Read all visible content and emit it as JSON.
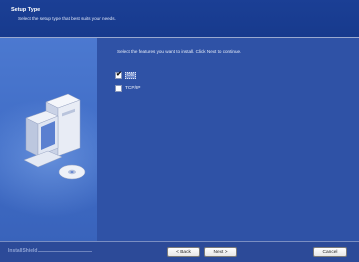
{
  "header": {
    "title": "Setup Type",
    "subtitle": "Select the setup type that best suits your needs."
  },
  "main": {
    "instruction": "Select the features you want to install. Click Next to continue.",
    "features": [
      {
        "label": "OS",
        "checked": true
      },
      {
        "label": "TCP/IP",
        "checked": false
      }
    ]
  },
  "footer": {
    "brand": "InstallShield",
    "back_label": "< Back",
    "next_label": "Next >",
    "cancel_label": "Cancel"
  },
  "colors": {
    "header_bg": "#1b3f95",
    "panel_bg": "#2f52a6",
    "left_panel_bg": "#4c79d0"
  },
  "icons": {
    "illustration": "computer-with-cd-icon",
    "check": "checkmark-icon"
  }
}
